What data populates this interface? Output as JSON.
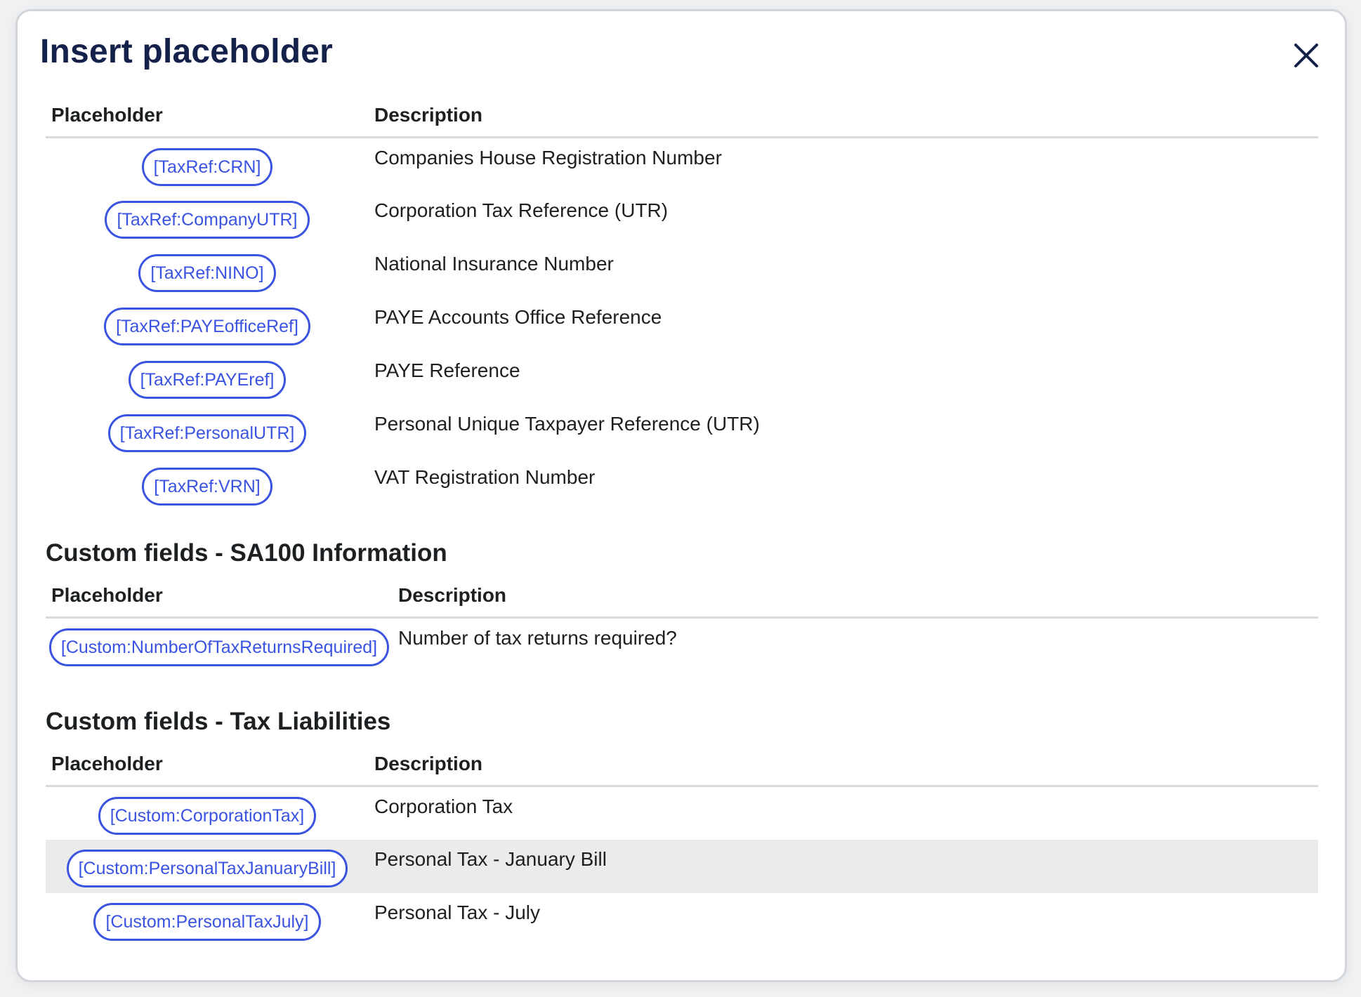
{
  "dialog": {
    "title": "Insert placeholder"
  },
  "colors": {
    "title": "#14214a",
    "pill_border": "#3a53e0",
    "pill_text": "#3a53e0",
    "row_highlight": "#ebebec"
  },
  "icons": {
    "close": "close-icon"
  },
  "tax_refs": {
    "headers": {
      "placeholder": "Placeholder",
      "description": "Description"
    },
    "rows": [
      {
        "placeholder": "[TaxRef:CRN]",
        "description": "Companies House Registration Number"
      },
      {
        "placeholder": "[TaxRef:CompanyUTR]",
        "description": "Corporation Tax Reference (UTR)"
      },
      {
        "placeholder": "[TaxRef:NINO]",
        "description": "National Insurance Number"
      },
      {
        "placeholder": "[TaxRef:PAYEofficeRef]",
        "description": "PAYE Accounts Office Reference"
      },
      {
        "placeholder": "[TaxRef:PAYEref]",
        "description": "PAYE Reference"
      },
      {
        "placeholder": "[TaxRef:PersonalUTR]",
        "description": "Personal Unique Taxpayer Reference (UTR)"
      },
      {
        "placeholder": "[TaxRef:VRN]",
        "description": "VAT Registration Number"
      }
    ]
  },
  "sa100": {
    "title": "Custom fields - SA100 Information",
    "headers": {
      "placeholder": "Placeholder",
      "description": "Description"
    },
    "rows": [
      {
        "placeholder": "[Custom:NumberOfTaxReturnsRequired]",
        "description": "Number of tax returns required?"
      }
    ]
  },
  "tax_liabilities": {
    "title": "Custom fields - Tax Liabilities",
    "headers": {
      "placeholder": "Placeholder",
      "description": "Description"
    },
    "rows": [
      {
        "placeholder": "[Custom:CorporationTax]",
        "description": "Corporation Tax"
      },
      {
        "placeholder": "[Custom:PersonalTaxJanuaryBill]",
        "description": "Personal Tax - January Bill"
      },
      {
        "placeholder": "[Custom:PersonalTaxJuly]",
        "description": "Personal Tax - July"
      }
    ]
  }
}
